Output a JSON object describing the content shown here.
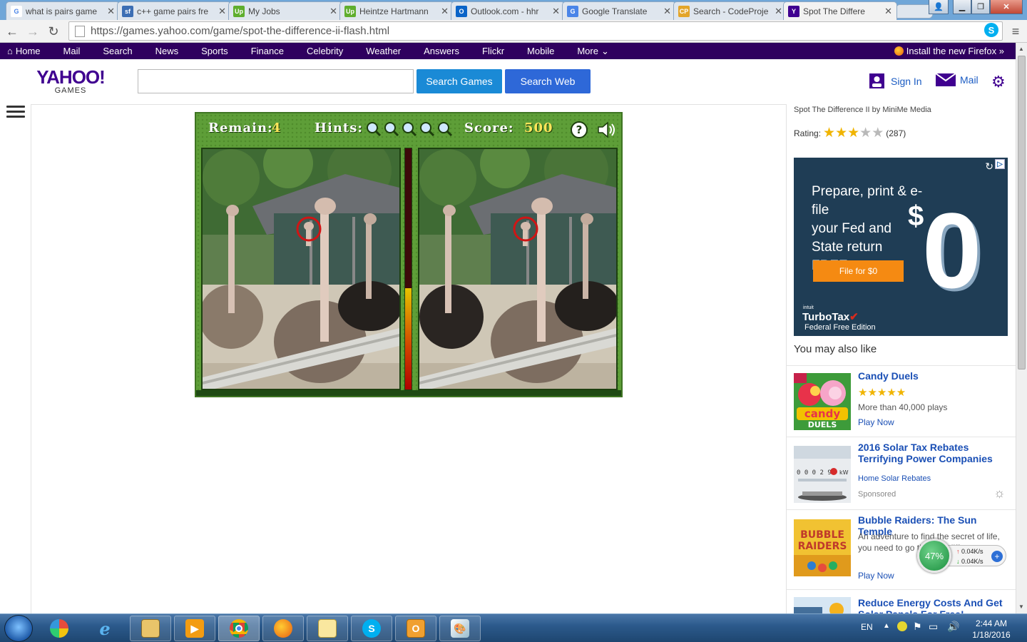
{
  "browser": {
    "tabs": [
      {
        "title": "what is pairs game",
        "fav": "G",
        "fav_color": "#ffffff"
      },
      {
        "title": "c++ game pairs fre",
        "fav": "sf",
        "fav_color": "#3c6eb4"
      },
      {
        "title": "My Jobs",
        "fav": "Up",
        "fav_color": "#5fae2e"
      },
      {
        "title": "Heintze Hartmann",
        "fav": "Up",
        "fav_color": "#5fae2e"
      },
      {
        "title": "Outlook.com - hhr",
        "fav": "O",
        "fav_color": "#0a64c8"
      },
      {
        "title": "Google Translate",
        "fav": "G",
        "fav_color": "#4a85e8"
      },
      {
        "title": "Search - CodeProje",
        "fav": "CP",
        "fav_color": "#e3a52a"
      },
      {
        "title": "Spot The Differe",
        "fav": "Y",
        "fav_color": "#400090",
        "active": true
      }
    ],
    "url": "https://games.yahoo.com/game/spot-the-difference-ii-flash.html"
  },
  "ynav": {
    "items": [
      "Home",
      "Mail",
      "Search",
      "News",
      "Sports",
      "Finance",
      "Celebrity",
      "Weather",
      "Answers",
      "Flickr",
      "Mobile",
      "More"
    ],
    "firefox": "Install the new Firefox »"
  },
  "header": {
    "logo_main": "YAHOO!",
    "logo_sub": "GAMES",
    "search_placeholder": "",
    "search_games": "Search Games",
    "search_web": "Search Web",
    "sign_in": "Sign In",
    "mail": "Mail"
  },
  "game": {
    "remain_label": "Remain:",
    "remain_value": "4",
    "hints_label": "Hints:",
    "hints_count": 5,
    "score_label": "Score:",
    "score_value": "500",
    "meter_level": 0.42
  },
  "sidebar": {
    "game_title": "Spot The Difference II by MiniMe Media",
    "rating_label": "Rating:",
    "rating_stars": 3,
    "rating_count": "(287)",
    "ad": {
      "headline_lines": [
        "Prepare, print & e-file",
        "your Fed and",
        "State return",
        "FREE."
      ],
      "dollar": "$",
      "zero": "0",
      "cta": "File for $0",
      "intuit": "intuit",
      "brand": "TurboTax",
      "edition": "Federal Free Edition"
    },
    "you_may_also_like": "You may also like",
    "recs": [
      {
        "title": "Candy Duels",
        "stars": "★★★★★",
        "desc": "More than 40,000 plays",
        "link": "Play Now"
      },
      {
        "title": "2016 Solar Tax Rebates Terrifying Power Companies",
        "link": "Home Solar Rebates",
        "sponsored": "Sponsored"
      },
      {
        "title": "Bubble Raiders: The Sun Temple",
        "desc": "An adventure to find the secret of life, you need to go through differe",
        "link": "Play Now"
      },
      {
        "title": "Reduce Energy Costs And Get Solar Panels For Free!"
      }
    ]
  },
  "netwidget": {
    "percent": "47%",
    "up": "0.04K/s",
    "down": "0.04K/s"
  },
  "taskbar": {
    "lang": "EN",
    "time": "2:44 AM",
    "date": "1/18/2016"
  }
}
